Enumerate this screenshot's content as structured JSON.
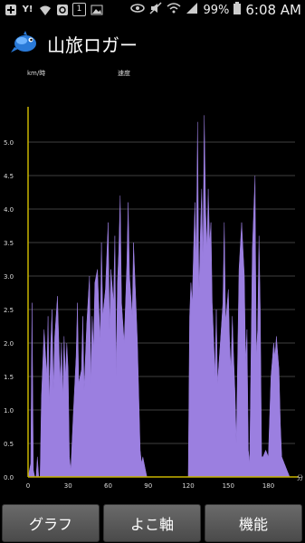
{
  "status_bar": {
    "icons_left": [
      "plus-icon",
      "yahoo-icon",
      "wifi-icon",
      "sync-icon",
      "notification-1-icon",
      "image-icon"
    ],
    "notification_count": "1",
    "yahoo_label": "Y!",
    "battery": "99%",
    "time": "6:08 AM"
  },
  "app_bar": {
    "title": "山旅ロガー"
  },
  "chart_data": {
    "type": "area",
    "ylabel": "km/時",
    "title": "速度",
    "xunit": "分",
    "ylim": [
      0,
      5.5
    ],
    "xlim": [
      0,
      200
    ],
    "y_ticks": [
      "0.0",
      "0.5",
      "1.0",
      "1.5",
      "2.0",
      "2.5",
      "3.0",
      "3.5",
      "4.0",
      "4.5",
      "5.0"
    ],
    "x_ticks": [
      "0",
      "30",
      "60",
      "90",
      "120",
      "150",
      "180"
    ],
    "grid": true,
    "color": "#9b7fe0",
    "axis_color": "#c8b400",
    "x": [
      0,
      2,
      3,
      4,
      5,
      6,
      7,
      8,
      9,
      10,
      12,
      14,
      15,
      16,
      17,
      18,
      19,
      20,
      22,
      24,
      25,
      26,
      27,
      28,
      29,
      30,
      31,
      32,
      34,
      36,
      37,
      38,
      40,
      41,
      42,
      44,
      46,
      47,
      48,
      49,
      50,
      52,
      54,
      55,
      56,
      58,
      60,
      61,
      62,
      64,
      65,
      66,
      67,
      68,
      69,
      70,
      72,
      74,
      75,
      76,
      78,
      79,
      80,
      81,
      82,
      84,
      85,
      86,
      88,
      89,
      90,
      91,
      92,
      93,
      94,
      96,
      98,
      99,
      100,
      102,
      104,
      106,
      108,
      110,
      112,
      114,
      116,
      117,
      118,
      120,
      121,
      122,
      123,
      124,
      125,
      126,
      127,
      128,
      129,
      130,
      131,
      132,
      133,
      134,
      135,
      136,
      137,
      138,
      139,
      140,
      141,
      142,
      144,
      146,
      147,
      148,
      150,
      151,
      152,
      153,
      154,
      155,
      156,
      158,
      160,
      162,
      163,
      164,
      165,
      166,
      168,
      170,
      171,
      172,
      173,
      174,
      175,
      176,
      178,
      180,
      182,
      184,
      185,
      186,
      188,
      189,
      190,
      192,
      194,
      196,
      198,
      200
    ],
    "y": [
      0,
      0.2,
      2.6,
      0.1,
      0,
      0,
      0.3,
      0,
      0,
      1.2,
      2.2,
      1.5,
      2.4,
      1.1,
      2.0,
      2.5,
      1.3,
      2.1,
      2.7,
      1.4,
      2.0,
      1.2,
      2.1,
      1.5,
      2.0,
      1.6,
      0.3,
      0.1,
      1.0,
      1.8,
      2.6,
      1.4,
      1.6,
      2.4,
      1.3,
      2.3,
      3.0,
      1.4,
      2.4,
      1.9,
      2.9,
      3.1,
      2.0,
      3.5,
      2.4,
      2.8,
      3.8,
      2.2,
      3.1,
      2.6,
      3.6,
      1.5,
      2.9,
      3.4,
      4.2,
      2.6,
      2.0,
      3.2,
      4.1,
      3.0,
      2.4,
      3.5,
      3.0,
      2.5,
      2.0,
      0.4,
      0.2,
      0.3,
      0.1,
      0,
      0,
      0,
      0,
      0,
      0,
      0,
      0,
      0,
      0,
      0,
      0,
      0,
      0,
      0,
      0,
      0,
      0,
      0,
      0,
      0,
      2.4,
      2.9,
      2.6,
      3.4,
      4.1,
      3.2,
      5.3,
      2.7,
      3.6,
      4.3,
      3.2,
      5.4,
      4.0,
      3.4,
      4.3,
      3.5,
      3.8,
      2.6,
      2.1,
      1.5,
      2.5,
      1.4,
      2.0,
      2.6,
      3.8,
      2.3,
      2.8,
      2.0,
      1.6,
      2.4,
      1.8,
      1.3,
      0.5,
      3.1,
      3.8,
      3.0,
      1.7,
      2.2,
      0.4,
      0.2,
      3.4,
      4.5,
      1.8,
      2.2,
      3.6,
      2.5,
      0.3,
      0.3,
      0.4,
      0.3,
      1.5,
      2.0,
      1.8,
      2.1,
      1.6,
      0.8,
      0.3,
      0.2,
      0.1,
      0
    ]
  },
  "buttons": {
    "graph": "グラフ",
    "x_axis": "よこ軸",
    "functions": "機能"
  }
}
